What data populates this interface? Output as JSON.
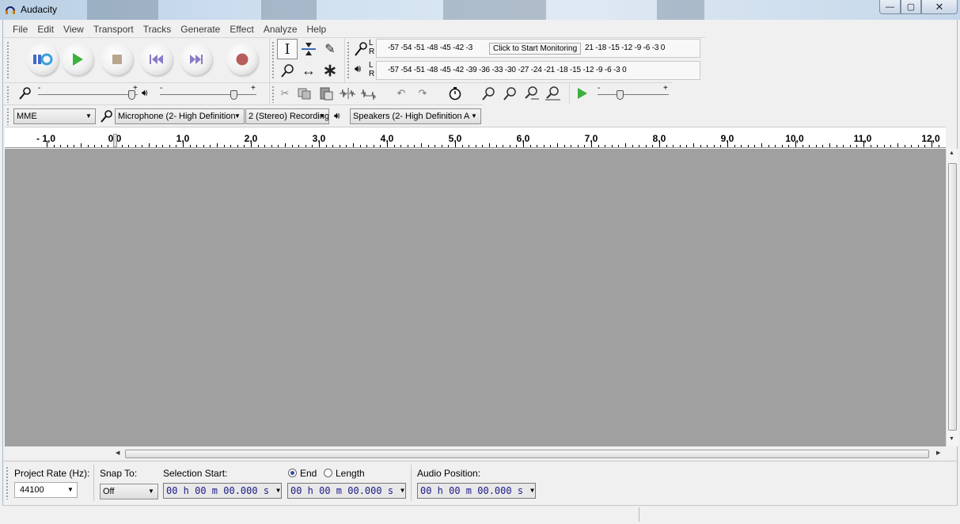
{
  "window": {
    "title": "Audacity",
    "controls": {
      "minimize": "—",
      "maximize": "▢",
      "close": "✕"
    }
  },
  "menu": [
    "File",
    "Edit",
    "View",
    "Transport",
    "Tracks",
    "Generate",
    "Effect",
    "Analyze",
    "Help"
  ],
  "transport": {
    "buttons": [
      {
        "name": "pause",
        "icon": "pause-icon"
      },
      {
        "name": "play",
        "icon": "play-icon"
      },
      {
        "name": "stop",
        "icon": "stop-icon"
      },
      {
        "name": "skip-to-start",
        "icon": "skip-start-icon"
      },
      {
        "name": "skip-to-end",
        "icon": "skip-end-icon"
      },
      {
        "name": "record",
        "icon": "record-icon"
      }
    ]
  },
  "tools": [
    "selection-tool",
    "envelope-tool",
    "draw-tool",
    "zoom-tool",
    "time-shift-tool",
    "multi-tool"
  ],
  "meters": {
    "record": {
      "channels": "L R",
      "ticks": "-57 -54 -51 -48 -45 -42 -3",
      "ticks_after": "21 -18 -15 -12  -9   -6   -3   0",
      "tooltip": "Click to Start Monitoring"
    },
    "playback": {
      "channels": "L R",
      "ticks": "-57 -54 -51 -48 -45 -42 -39 -36 -33 -30 -27 -24 -21 -18 -15 -12  -9   -6   -3   0"
    }
  },
  "mixer": {
    "minus": "-",
    "plus": "+"
  },
  "devices": {
    "host": "MME",
    "recording_device": "Microphone (2- High Definition",
    "recording_channels": "2 (Stereo) Recording",
    "playback_device": "Speakers (2- High Definition A"
  },
  "ruler": {
    "labels": [
      "- 1,0",
      "0,0",
      "1,0",
      "2,0",
      "3,0",
      "4,0",
      "5,0",
      "6,0",
      "7,0",
      "8,0",
      "9,0",
      "10,0",
      "11,0",
      "12,0"
    ]
  },
  "selection_toolbar": {
    "project_rate_label": "Project Rate (Hz):",
    "project_rate_value": "44100",
    "snap_to_label": "Snap To:",
    "snap_to_value": "Off",
    "selection_start_label": "Selection Start:",
    "end_label": "End",
    "length_label": "Length",
    "end_selected": true,
    "audio_position_label": "Audio Position:",
    "time_value": "00 h 00 m 00.000 s"
  },
  "colors": {
    "track_background": "#a0a0a0",
    "play_green": "#3db03d",
    "record_red": "#b85c5c"
  }
}
